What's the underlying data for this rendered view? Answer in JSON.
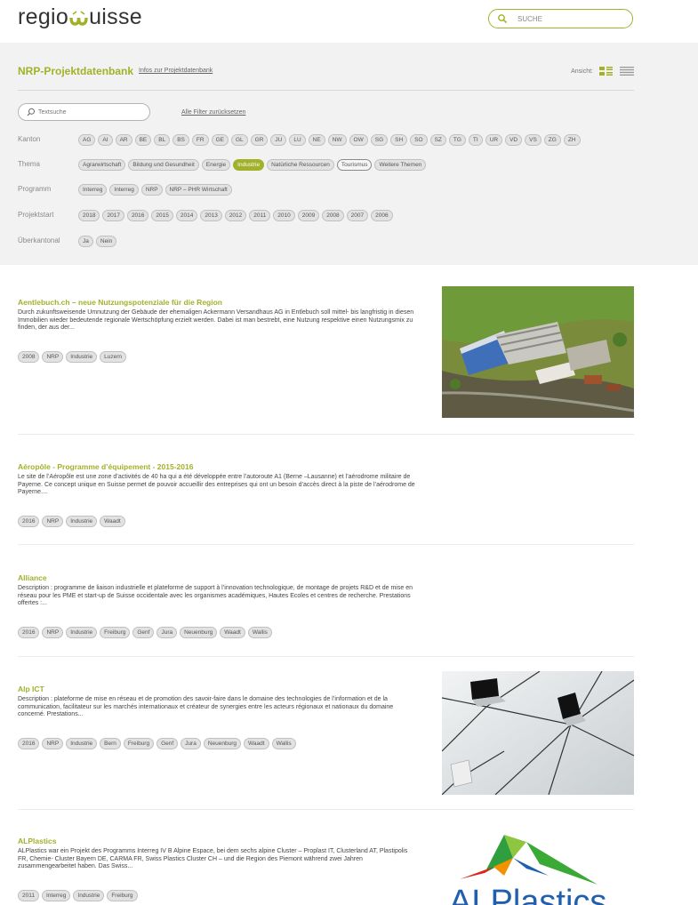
{
  "header": {
    "logo_pre": "regio",
    "logo_post": "uisse",
    "search_placeholder": "SUCHE"
  },
  "colors": {
    "accent": "#a2b12a",
    "chip_bg": "#e2e2e2",
    "panel_bg": "#f2f2f2"
  },
  "filter": {
    "title": "NRP-Projektdatenbank",
    "info_link": "Infos zur Projektdatenbank",
    "view_label": "Ansicht:",
    "text_search_placeholder": "Textsuche",
    "reset_link": "Alle Filter zurücksetzen",
    "kanton": {
      "label": "Kanton",
      "options": [
        "AG",
        "AI",
        "AR",
        "BE",
        "BL",
        "BS",
        "FR",
        "GE",
        "GL",
        "GR",
        "JU",
        "LU",
        "NE",
        "NW",
        "OW",
        "SG",
        "SH",
        "SO",
        "SZ",
        "TG",
        "TI",
        "UR",
        "VD",
        "VS",
        "ZG",
        "ZH"
      ]
    },
    "thema": {
      "label": "Thema",
      "options": [
        "Agrarwirtschaft",
        "Bildung und Gesundheit",
        "Energie",
        "Industrie",
        "Natürliche Ressourcen",
        "Tourismus",
        "Weitere Themen"
      ],
      "active": "Industrie",
      "outlined": "Tourismus"
    },
    "programm": {
      "label": "Programm",
      "options": [
        "Interreg",
        "Interreg",
        "NRP",
        "NRP – PHR Wirtschaft"
      ]
    },
    "projektstart": {
      "label": "Projektstart",
      "options": [
        "2018",
        "2017",
        "2016",
        "2015",
        "2014",
        "2013",
        "2012",
        "2011",
        "2010",
        "2009",
        "2008",
        "2007",
        "2006"
      ]
    },
    "ueberkantonal": {
      "label": "Überkantonal",
      "options": [
        "Ja",
        "Nein"
      ]
    }
  },
  "projects": [
    {
      "title": "Aentlebuch.ch – neue Nutzungspotenziale für die Region",
      "description": "Durch zukunftsweisende Umnutzung der Gebäude der ehemaligen Ackermann Versandhaus AG in Entlebuch soll mittel- bis langfristig in diesen Immobilien wieder bedeutende regionale Wertschöpfung erzielt werden. Dabei ist man bestrebt, eine Nutzung respektive einen Nutzungsmix zu finden, der aus der...",
      "tags": [
        "2008",
        "NRP",
        "Industrie",
        "Luzern"
      ],
      "image": "aerial-factory"
    },
    {
      "title": "Aéropôle - Programme d’équipement - 2015-2016",
      "description": "Le site de l’Aéropôle est une zone d’activités de 40 ha qui a été développée entre l’autoroute A1 (Berne –Lausanne) et l’aérodrome militaire de Payerne. Ce concept unique en Suisse permet de pouvoir accueillir des entreprises qui ont un besoin d’accès direct à la piste de l’aérodrome de Payerne....",
      "tags": [
        "2016",
        "NRP",
        "Industrie",
        "Waadt"
      ],
      "image": ""
    },
    {
      "title": "Alliance",
      "description": "Description : programme de liaison industrielle et plateforme de support à l’innovation technologique, de montage de projets R&D et de mise en réseau pour les PME et start-up de Suisse occidentale avec les organismes académiques, Hautes Ecoles et centres de recherche. Prestations offertes :...",
      "tags": [
        "2016",
        "NRP",
        "Industrie",
        "Freiburg",
        "Genf",
        "Jura",
        "Neuenburg",
        "Waadt",
        "Wallis"
      ],
      "image": ""
    },
    {
      "title": "Alp ICT",
      "description": "Description : plateforme de mise en réseau et de promotion des savoir-faire dans le domaine des technologies de l’information et de la communication, facilitateur sur les marchés internationaux et créateur de synergies entre les acteurs régionaux et nationaux du domaine concerné. Prestations...",
      "tags": [
        "2016",
        "NRP",
        "Industrie",
        "Bern",
        "Freiburg",
        "Genf",
        "Jura",
        "Neuenburg",
        "Waadt",
        "Wallis"
      ],
      "image": "network-laptops"
    },
    {
      "title": "ALPlastics",
      "description": "ALPlastics war ein Projekt des Programms Interreg IV B Alpine Espace, bei dem sechs alpine Cluster – Proplast IT, Clusterland AT, Plastipolis FR, Chemie- Cluster Bayern DE, CARMA FR, Swiss Plastics Cluster CH – und die Region des Piemont während zwei Jahren zusammengearbeitet haben. Das Swiss...",
      "tags": [
        "2011",
        "Interreg",
        "Industrie",
        "Freiburg"
      ],
      "image": "alplastics-logo",
      "logo_text": "ALPlastics"
    }
  ]
}
